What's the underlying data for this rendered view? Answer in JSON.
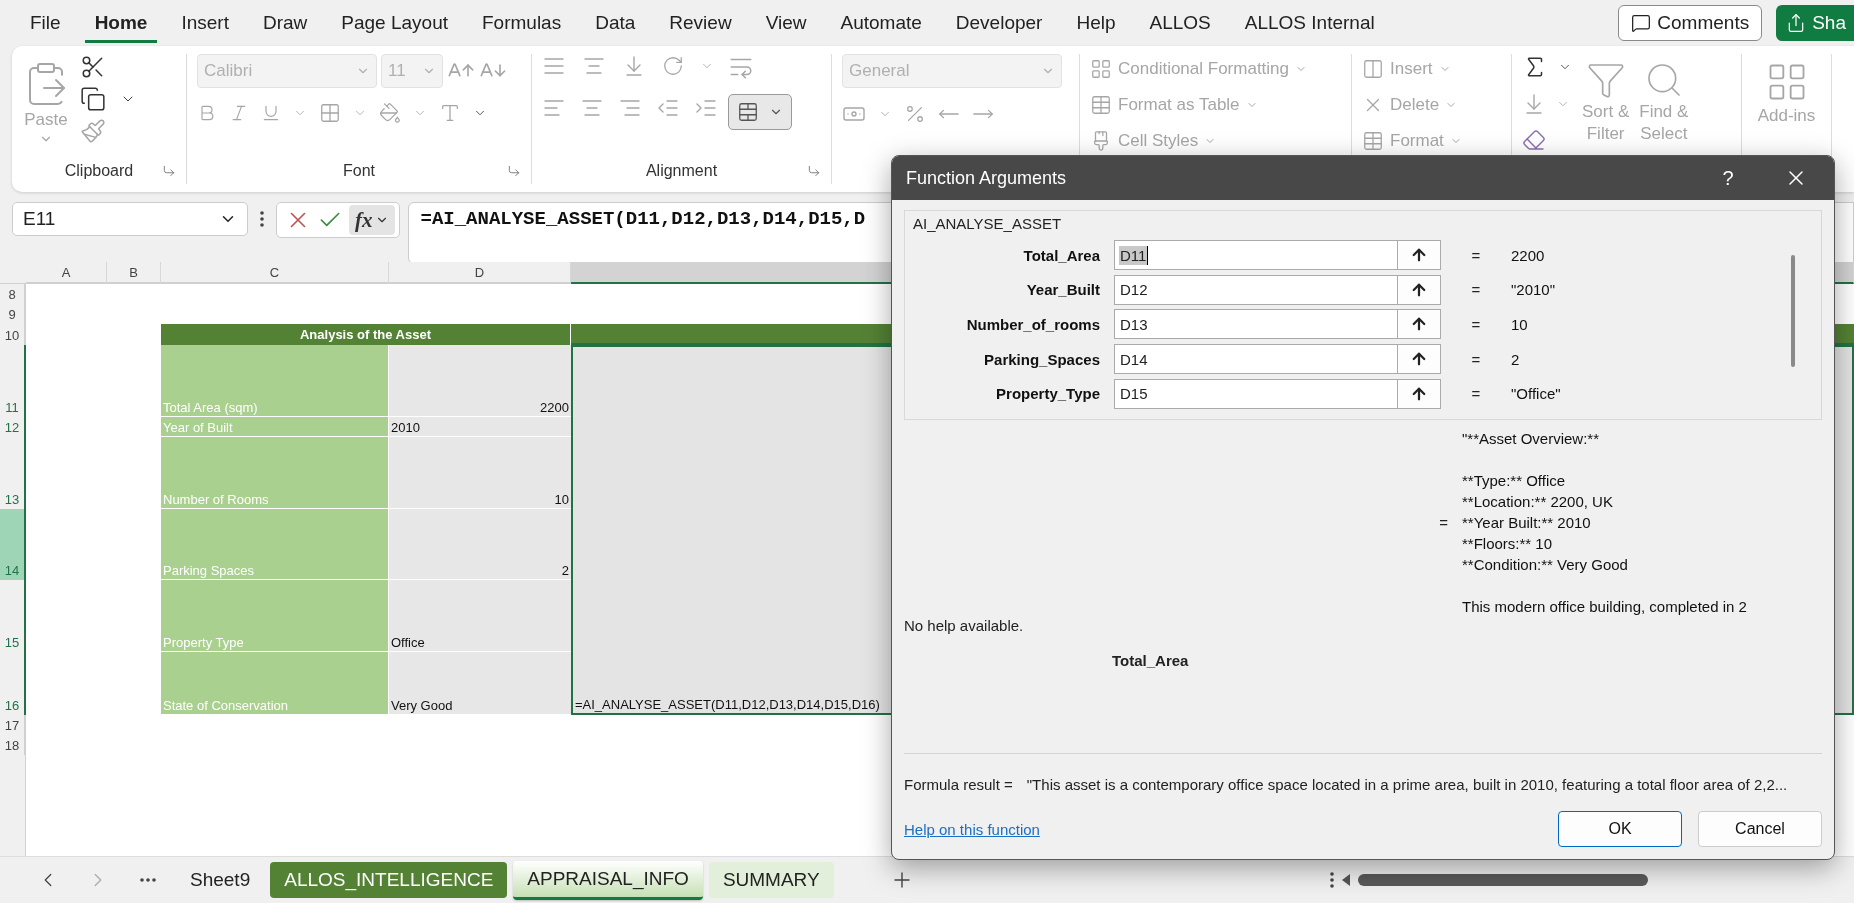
{
  "menu_tabs": [
    {
      "label": "File",
      "selected": false
    },
    {
      "label": "Home",
      "selected": true
    },
    {
      "label": "Insert",
      "selected": false
    },
    {
      "label": "Draw",
      "selected": false
    },
    {
      "label": "Page Layout",
      "selected": false
    },
    {
      "label": "Formulas",
      "selected": false
    },
    {
      "label": "Data",
      "selected": false
    },
    {
      "label": "Review",
      "selected": false
    },
    {
      "label": "View",
      "selected": false
    },
    {
      "label": "Automate",
      "selected": false
    },
    {
      "label": "Developer",
      "selected": false
    },
    {
      "label": "Help",
      "selected": false
    },
    {
      "label": "ALLOS",
      "selected": false
    },
    {
      "label": "ALLOS Internal",
      "selected": false
    }
  ],
  "comments_button": "Comments",
  "share_button": "Sha",
  "ribbon": {
    "disabled": true,
    "clipboard": {
      "paste": "Paste",
      "label": "Clipboard"
    },
    "font": {
      "font_name": "Calibri",
      "font_size": "11",
      "label": "Font"
    },
    "alignment": {
      "label": "Alignment"
    },
    "number": {
      "format": "General"
    },
    "styles": [
      "Conditional Formatting",
      "Format as Table",
      "Cell Styles"
    ],
    "cells": [
      "Insert",
      "Delete",
      "Format"
    ],
    "editing": {
      "sort": [
        "Sort &",
        "Filter"
      ],
      "find": [
        "Find &",
        "Select"
      ]
    },
    "addins": "Add-ins"
  },
  "formula_bar": {
    "name_box": "E11",
    "fx": "fx",
    "formula": "=AI_ANALYSE_ASSET(D11,D12,D13,D14,D15,D"
  },
  "sheet": {
    "columns": [
      {
        "label": "A",
        "selected": false
      },
      {
        "label": "B",
        "selected": false
      },
      {
        "label": "C",
        "selected": false
      },
      {
        "label": "D",
        "selected": false
      },
      {
        "selected": true
      }
    ],
    "rows": [
      {
        "number": "8",
        "selected": false,
        "hovered": false
      },
      {
        "number": "9",
        "selected": false,
        "hovered": false
      },
      {
        "number": "10",
        "selected": false,
        "hovered": false
      },
      {
        "number": "11",
        "selected": true,
        "hovered": false
      },
      {
        "number": "12",
        "selected": true,
        "hovered": false
      },
      {
        "number": "13",
        "selected": true,
        "hovered": false
      },
      {
        "number": "14",
        "selected": true,
        "hovered": true
      },
      {
        "number": "15",
        "selected": true,
        "hovered": false
      },
      {
        "number": "16",
        "selected": true,
        "hovered": false
      },
      {
        "number": "17",
        "selected": false,
        "hovered": false
      },
      {
        "number": "18",
        "selected": false,
        "hovered": false
      }
    ],
    "table_title": "Analysis of the Asset",
    "table_rows": [
      {
        "label": "Total Area (sqm)",
        "value": "2200",
        "kind": "number"
      },
      {
        "label": "Year of Built",
        "value": "2010",
        "kind": "text"
      },
      {
        "label": "Number of Rooms",
        "value": "10",
        "kind": "number"
      },
      {
        "label": "Parking Spaces",
        "value": "2",
        "kind": "number"
      },
      {
        "label": "Property Type",
        "value": "Office",
        "kind": "text"
      },
      {
        "label": "State of Conservation",
        "value": "Very Good",
        "kind": "text"
      }
    ],
    "result_cell": "=AI_ANALYSE_ASSET(D11,D12,D13,D14,D15,D16)"
  },
  "sheet_tabs": [
    {
      "label": "Sheet9",
      "selected": false
    },
    {
      "label": "ALLOS_INTELLIGENCE",
      "selected": false,
      "color": "#548235"
    },
    {
      "label": "APPRAISAL_INFO",
      "selected": true,
      "color": "#c6e0b4"
    },
    {
      "label": "SUMMARY",
      "selected": false,
      "color": "#e2efda"
    }
  ],
  "dialog": {
    "title": "Function Arguments",
    "help": "?",
    "function_name": "AI_ANALYSE_ASSET",
    "arguments": [
      {
        "name": "Total_Area",
        "ref": "D11",
        "value": "2200",
        "focused": true
      },
      {
        "name": "Year_Built",
        "ref": "D12",
        "value": "\"2010\"",
        "focused": false
      },
      {
        "name": "Number_of_rooms",
        "ref": "D13",
        "value": "10",
        "focused": false
      },
      {
        "name": "Parking_Spaces",
        "ref": "D14",
        "value": "2",
        "focused": false
      },
      {
        "name": "Property_Type",
        "ref": "D15",
        "value": "\"Office\"",
        "focused": false
      }
    ],
    "equals": "=",
    "result_preview": [
      [
        "\"**Asset Overview:**"
      ],
      [
        "**Type:** Office",
        "**Location:** 2200, UK",
        "**Year Built:** 2010",
        "**Floors:** 10",
        "**Condition:** Very Good"
      ],
      [
        "This modern office building, completed in 2"
      ]
    ],
    "description": "No help available.",
    "argument_title": "Total_Area",
    "formula_result_label": "Formula result =",
    "formula_result": "\"This asset is a contemporary office space located in a prime area, built in 2010, featuring a total floor area of 2,2...",
    "help_link": "Help on this function",
    "ok": "OK",
    "cancel": "Cancel"
  }
}
